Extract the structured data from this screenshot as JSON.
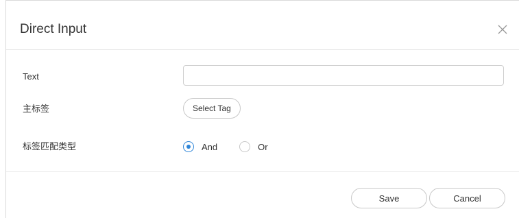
{
  "dialog": {
    "title": "Direct Input",
    "close_icon": "close-icon"
  },
  "form": {
    "text_label": "Text",
    "text_value": "",
    "text_placeholder": "",
    "main_tag_label": "主标签",
    "select_tag_label": "Select Tag",
    "match_type_label": "标签匹配类型",
    "match_options": [
      {
        "label": "And",
        "checked": true
      },
      {
        "label": "Or",
        "checked": false
      }
    ]
  },
  "footer": {
    "save_label": "Save",
    "cancel_label": "Cancel"
  },
  "colors": {
    "accent": "#2f86d8",
    "border": "#c8c8c8",
    "text": "#333333"
  }
}
